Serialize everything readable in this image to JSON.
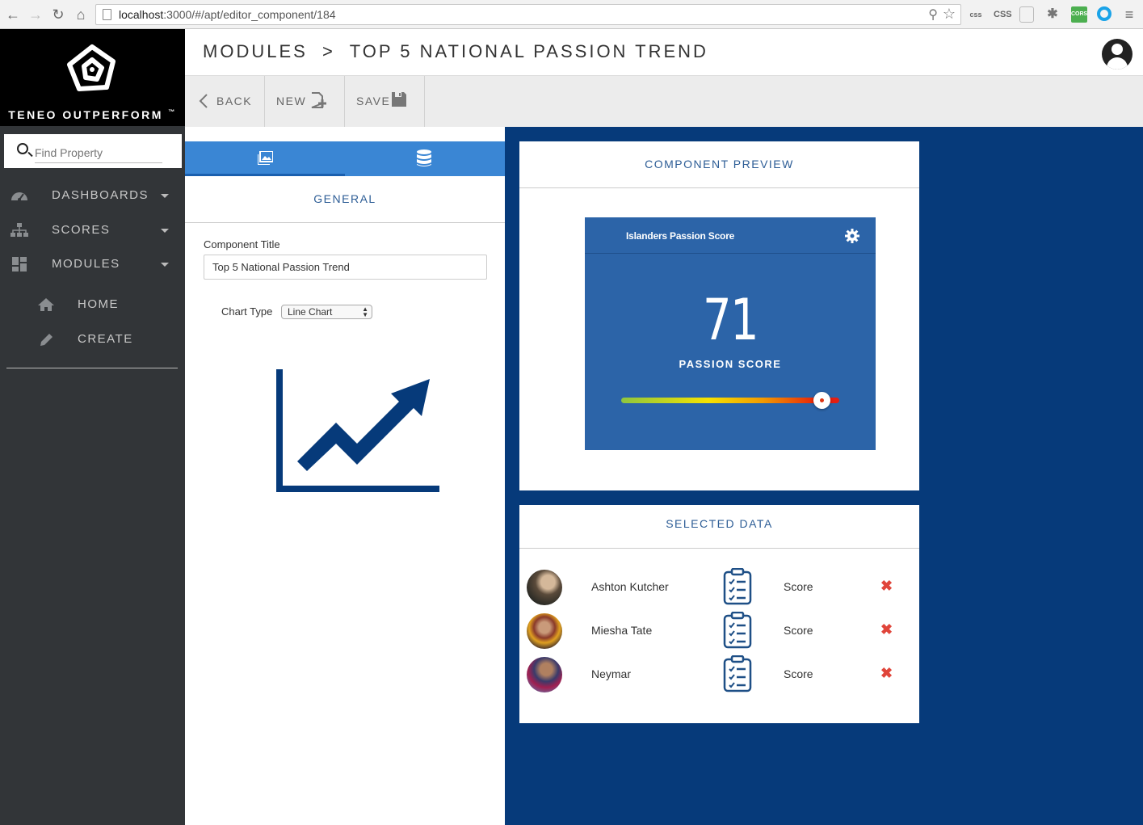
{
  "browser": {
    "url_host": "localhost",
    "url_rest": ":3000/#/apt/editor_component/184",
    "extensions": [
      "css",
      "CSS",
      "CORS"
    ]
  },
  "sidebar": {
    "brand": "TENEO OUTPERFORM",
    "brand_tm": "™",
    "search_placeholder": "Find Property",
    "items": [
      {
        "label": "DASHBOARDS",
        "icon": "dashboard-icon"
      },
      {
        "label": "SCORES",
        "icon": "sitemap-icon"
      },
      {
        "label": "MODULES",
        "icon": "modules-icon"
      }
    ],
    "subitems": [
      {
        "label": "HOME",
        "icon": "home-icon"
      },
      {
        "label": "CREATE",
        "icon": "pencil-icon"
      }
    ]
  },
  "header": {
    "breadcrumb": "MODULES  >  TOP 5 NATIONAL PASSION TREND"
  },
  "toolbar": {
    "back_label": "BACK",
    "new_label": "NEW",
    "save_label": "SAVE"
  },
  "editor": {
    "section_title": "GENERAL",
    "component_title_label": "Component Title",
    "component_title_value": "Top 5 National Passion Trend",
    "chart_type_label": "Chart Type",
    "chart_type_value": "Line Chart"
  },
  "preview": {
    "title": "COMPONENT PREVIEW",
    "widget_title": "Islanders Passion Score",
    "score": "71",
    "score_label": "PASSION SCORE",
    "slider_level": 0.92
  },
  "selected_data": {
    "title": "SELECTED DATA",
    "rows": [
      {
        "name": "Ashton Kutcher",
        "metric": "Score"
      },
      {
        "name": "Miesha Tate",
        "metric": "Score"
      },
      {
        "name": "Neymar",
        "metric": "Score"
      }
    ]
  },
  "colors": {
    "accent": "#3a86d4",
    "main_bg": "#063a7a",
    "widget_bg": "#2c64a8",
    "title_blue": "#2d5d96",
    "remove_red": "#e0453a"
  }
}
